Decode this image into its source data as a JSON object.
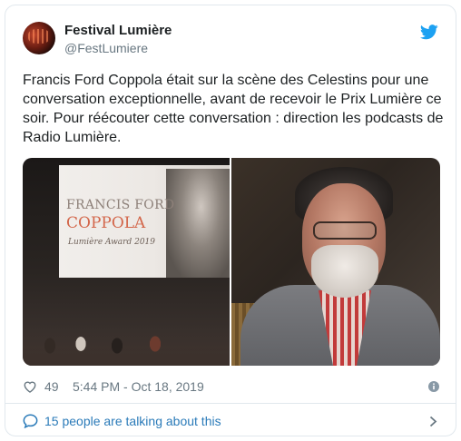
{
  "tweet": {
    "display_name": "Festival Lumière",
    "handle": "@FestLumiere",
    "text": "Francis Ford Coppola était sur la scène des Celestins pour une conversation exceptionnelle, avant de recevoir le Prix Lumière ce soir. Pour réécouter cette conversation : direction les podcasts de Radio Lumière.",
    "likes": "49",
    "timestamp": "5:44 PM - Oct 18, 2019",
    "talking": "15 people are talking about this"
  },
  "media": {
    "screen_line1": "FRANCIS FORD",
    "screen_line2": "COPPOLA",
    "screen_line3": "Lumière Award 2019"
  },
  "colors": {
    "accent": "#1da1f2",
    "link": "#2b7bb9",
    "muted": "#697882",
    "border": "#e1e8ed"
  },
  "icons": [
    "twitter-bird-icon",
    "heart-icon",
    "info-icon",
    "speech-bubble-icon",
    "chevron-right-icon"
  ]
}
